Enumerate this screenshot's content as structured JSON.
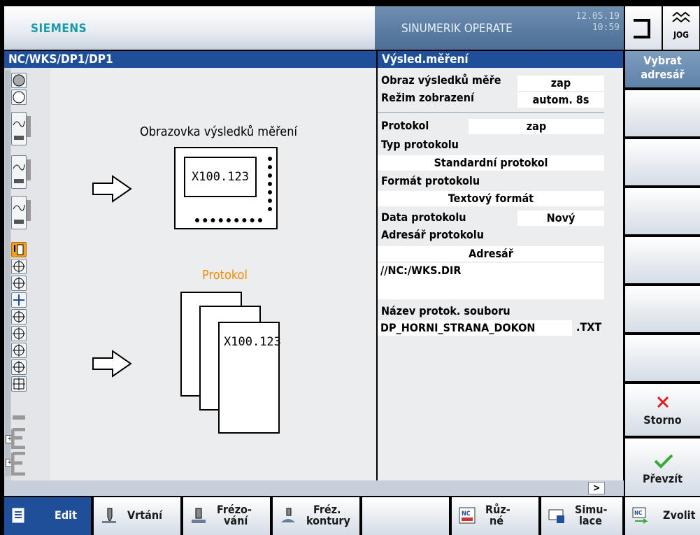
{
  "header": {
    "brand": "SIEMENS",
    "product": "SINUMERIK OPERATE",
    "date": "12.05.19",
    "time": "10:59",
    "jog_label": "JOG"
  },
  "title_bar": {
    "path": "NC/WKS/DP1/DP1",
    "section": "Výsled.měření"
  },
  "diagram": {
    "screen_title": "Obrazovka výsledků měření",
    "screen_value": "X100.123",
    "protocol_title": "Protokol",
    "protocol_value": "X100.123"
  },
  "form": {
    "result_screen_label": "Obraz výsledků měře",
    "result_screen_value": "zap",
    "display_mode_label": "Režim zobrazení",
    "display_mode_value": "autom. 8s",
    "protocol_label": "Protokol",
    "protocol_value": "zap",
    "protocol_type_label": "Typ protokolu",
    "protocol_type_value": "Standardní protokol",
    "protocol_format_label": "Formát protokolu",
    "protocol_format_value": "Textový formát",
    "protocol_data_label": "Data protokolu",
    "protocol_data_value": "Nový",
    "protocol_dir_label": "Adresář protokolu",
    "protocol_dir_value": "Adresář",
    "protocol_dir_path": "//NC:/WKS.DIR",
    "protocol_file_label": "Název protok. souboru",
    "protocol_file_value": "DP_HORNI_STRANA_DOKON",
    "protocol_file_ext": ".TXT"
  },
  "status": {
    "scroll_button": ">"
  },
  "vertical_softkeys": {
    "select_dir_line1": "Vybrat",
    "select_dir_line2": "adresář",
    "cancel": "Storno",
    "accept": "Převzít"
  },
  "horizontal_softkeys": {
    "edit": "Edit",
    "drilling": "Vrtání",
    "milling_line1": "Frézo-",
    "milling_line2": "vání",
    "contour_line1": "Fréz.",
    "contour_line2": "kontury",
    "misc_line1": "Růz-",
    "misc_line2": "né",
    "sim_line1": "Simu-",
    "sim_line2": "lace",
    "select": "Zvolit"
  },
  "colors": {
    "title_bar": "#1f4f99",
    "accent_orange": "#f08a00",
    "cancel_red": "#e11b1b",
    "accept_green": "#3aa935",
    "brand_teal": "#1a9aa6"
  }
}
